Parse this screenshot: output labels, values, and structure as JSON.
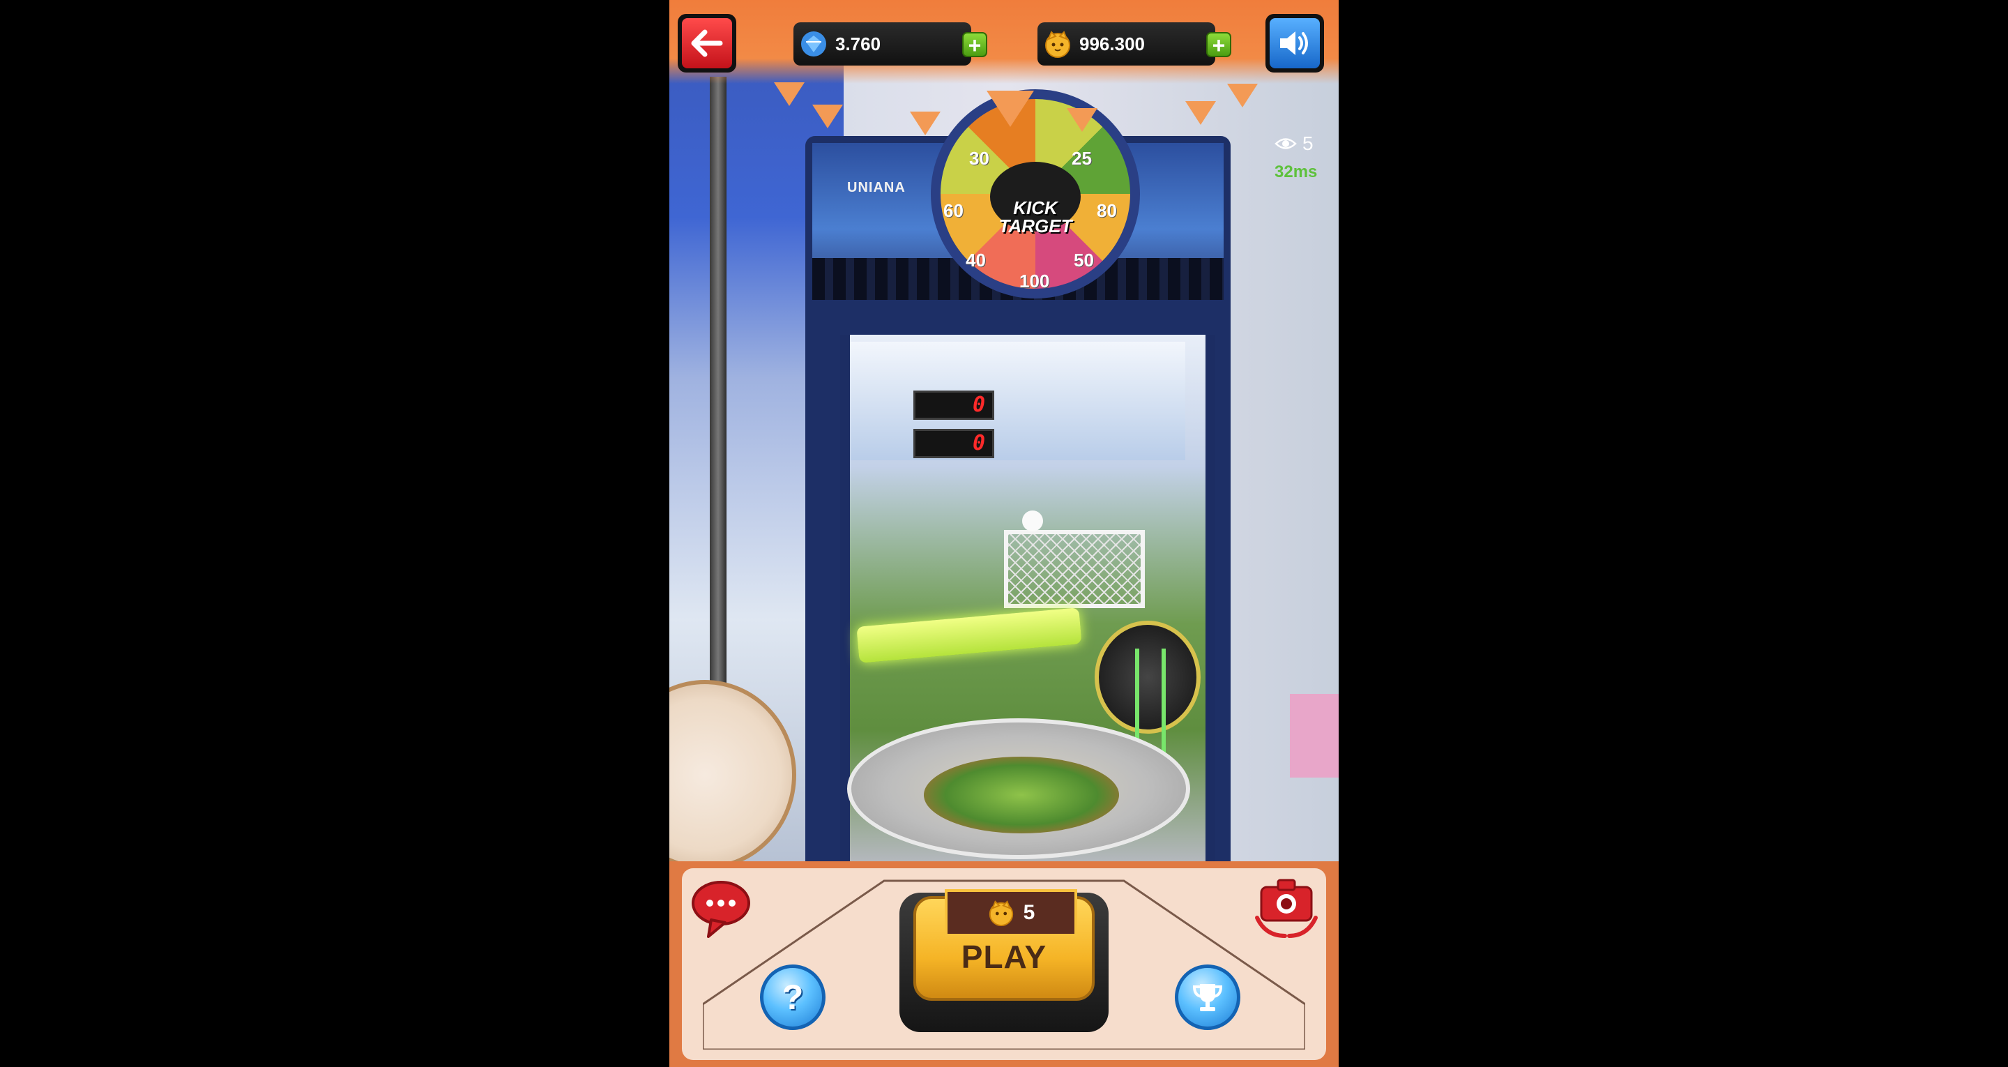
{
  "hud": {
    "gems": "3.760",
    "coins": "996.300",
    "viewers": "5",
    "latency": "32ms"
  },
  "machine": {
    "marquee_text": "UNIANA",
    "title_line1": "KICK",
    "title_line2": "TARGET",
    "wheel_numbers": [
      "30",
      "25",
      "60",
      "80",
      "50",
      "100",
      "40",
      "60"
    ],
    "score_next": "0",
    "score_first": "0"
  },
  "play": {
    "cost": "5",
    "label": "PLAY"
  },
  "colors": {
    "accent_orange": "#e07a43",
    "play_yellow": "#f5b426",
    "plus_green": "#6cc227",
    "back_red": "#e02a2a",
    "sound_blue": "#2f86e0",
    "latency_green": "#5ec13c"
  },
  "icons": {
    "back": "arrow-left-icon",
    "gem": "gem-icon",
    "coin": "cat-coin-icon",
    "sound": "speaker-icon",
    "viewers": "eye-icon",
    "chat": "chat-bubble-icon",
    "camera": "camera-switch-icon",
    "help": "question-icon",
    "trophy": "trophy-icon"
  }
}
